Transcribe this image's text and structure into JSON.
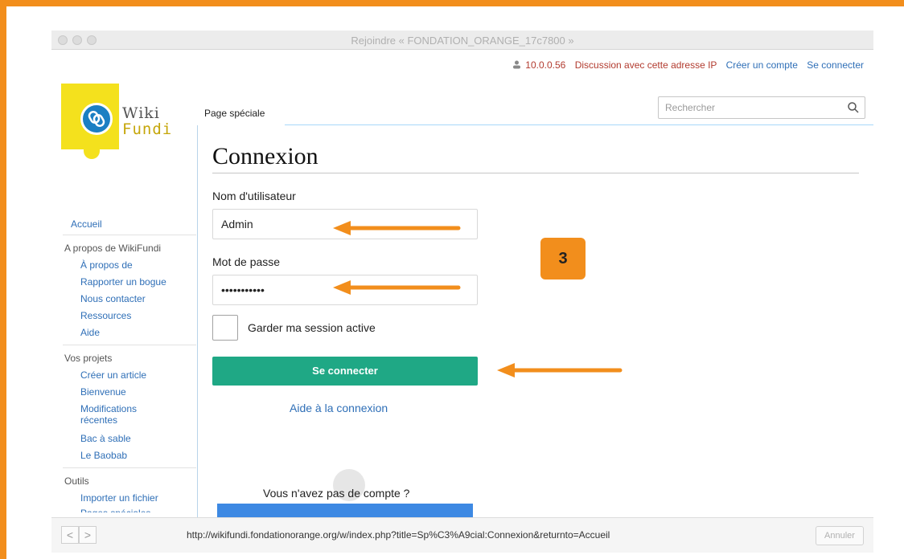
{
  "window": {
    "title": "Rejoindre « FONDATION_ORANGE_17c7800 »"
  },
  "personal": {
    "ip": "10.0.0.56",
    "discussion": "Discussion avec cette adresse IP",
    "create_account": "Créer un compte",
    "login": "Se connecter"
  },
  "logo": {
    "line1": "Wiki",
    "line2": "Fundi"
  },
  "tab": {
    "label": "Page spéciale"
  },
  "search": {
    "placeholder": "Rechercher",
    "icon": "search-icon"
  },
  "page": {
    "title": "Connexion"
  },
  "form": {
    "username_label": "Nom d'utilisateur",
    "username_value": "Admin",
    "password_label": "Mot de passe",
    "password_value": "•••••••••••",
    "remember_label": "Garder ma session active",
    "submit_label": "Se connecter",
    "help_link": "Aide à la connexion",
    "no_account": "Vous n'avez pas de compte ?"
  },
  "badge": {
    "text": "3"
  },
  "sidebar": {
    "home": "Accueil",
    "about_head": "A propos de WikiFundi",
    "about_items": [
      "À propos de",
      "Rapporter un bogue",
      "Nous contacter",
      "Ressources",
      "Aide"
    ],
    "projects_head": "Vos projets",
    "projects_items": [
      "Créer un article",
      "Bienvenue",
      "Modifications",
      "récentes",
      "Bac à sable",
      "Le Baobab"
    ],
    "tools_head": "Outils",
    "tools_items": [
      "Importer un fichier",
      "Pages spéciales"
    ]
  },
  "statusbar": {
    "back": "<",
    "forward": ">",
    "url": "http://wikifundi.fondationorange.org/w/index.php?title=Sp%C3%A9cial:Connexion&returnto=Accueil",
    "cancel": "Annuler"
  },
  "colors": {
    "frame": "#f28e1c",
    "accent_green": "#1fa885",
    "link_blue": "#2f6fb7",
    "arrow_orange": "#f28e1c"
  }
}
